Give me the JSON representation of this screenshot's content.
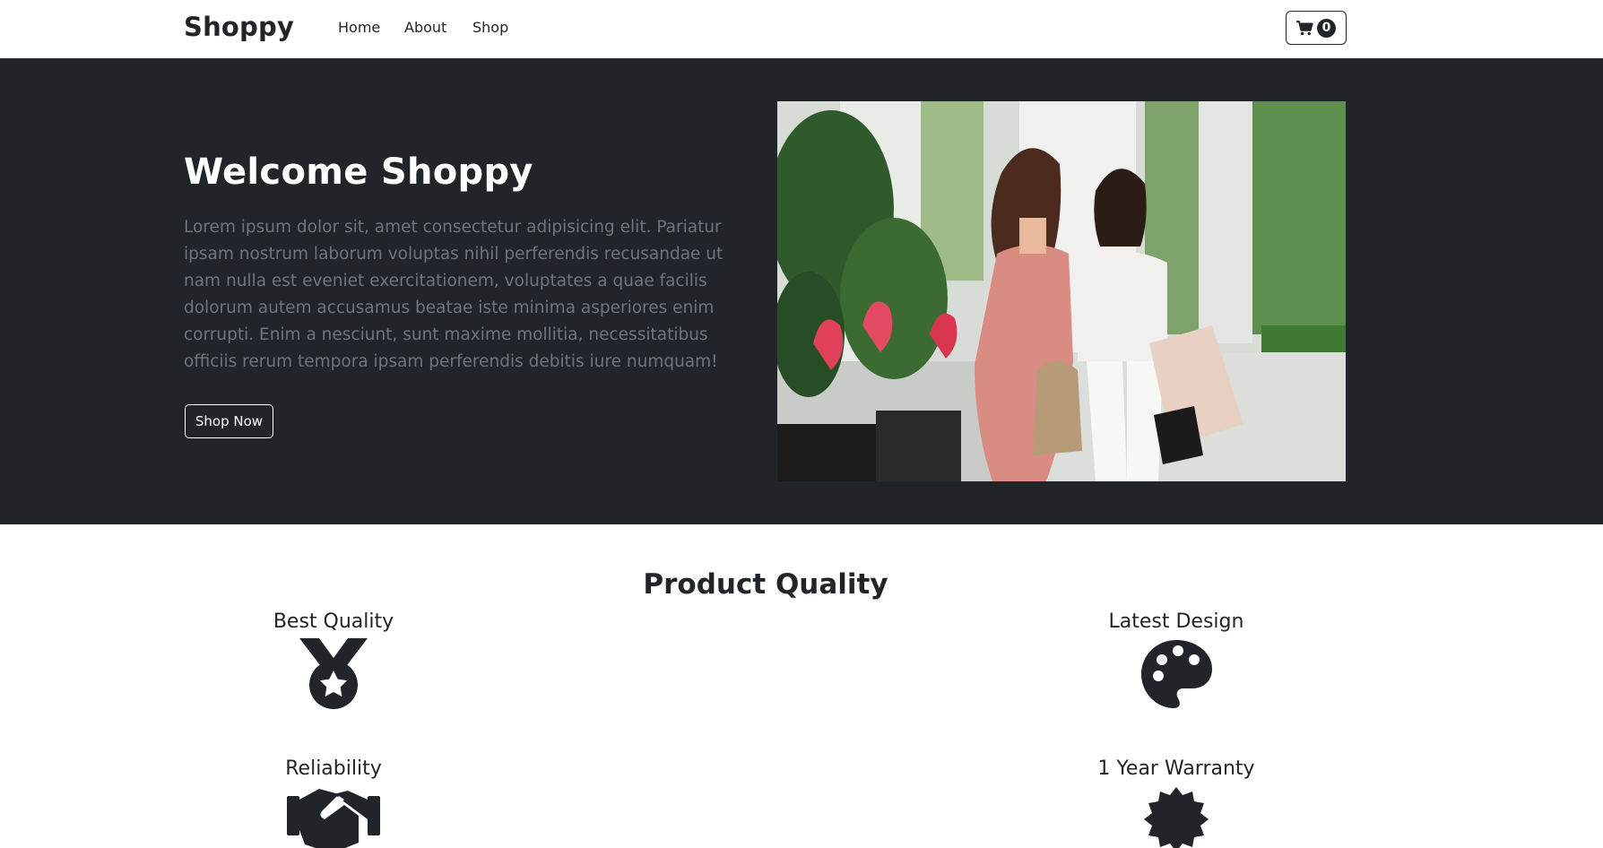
{
  "navbar": {
    "brand": "Shoppy",
    "links": [
      "Home",
      "About",
      "Shop"
    ],
    "cart_count": "0"
  },
  "hero": {
    "title": "Welcome Shoppy",
    "text": "Lorem ipsum dolor sit, amet consectetur adipisicing elit. Pariatur ipsam nostrum laborum voluptas nihil perferendis recusandae ut nam nulla est eveniet exercitationem, voluptates a quae facilis dolorum autem accusamus beatae iste minima asperiores enim corrupti. Enim a nesciunt, sunt maxime mollitia, necessitatibus officiis rerum tempora ipsam perferendis debitis iure numquam!",
    "button_label": "Shop Now"
  },
  "quality": {
    "title": "Product Quality",
    "features": [
      {
        "label": "Best Quality",
        "icon": "medal-icon"
      },
      {
        "label": "Latest Design",
        "icon": "palette-icon"
      },
      {
        "label": "Reliability",
        "icon": "handshake-icon"
      },
      {
        "label": "1 Year Warranty",
        "icon": "certificate-icon"
      }
    ]
  },
  "colors": {
    "dark": "#212529",
    "muted_text": "#6c757d",
    "white": "#ffffff"
  }
}
